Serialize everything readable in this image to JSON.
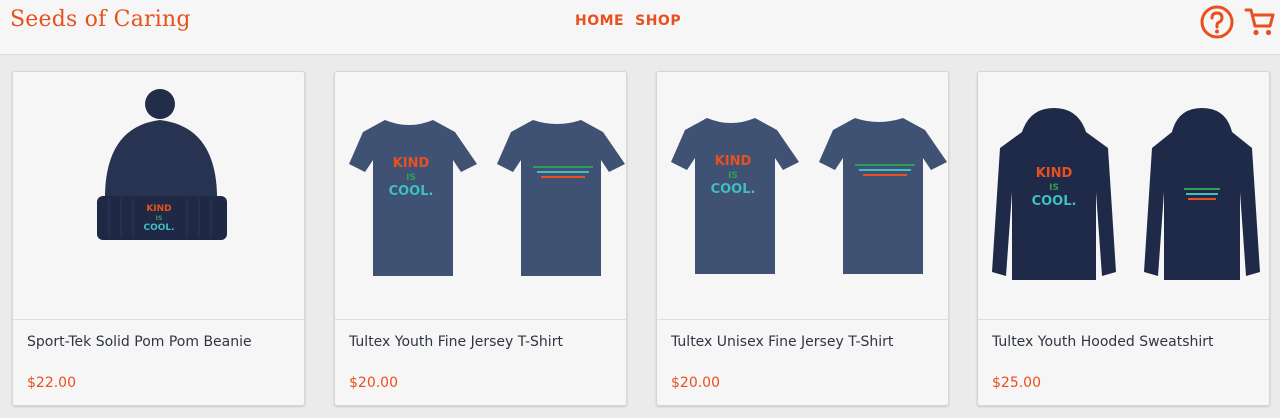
{
  "header": {
    "brand": "Seeds of Caring",
    "nav": [
      {
        "label": "HOME"
      },
      {
        "label": "SHOP"
      }
    ],
    "icons": {
      "help": "help-circle-icon",
      "cart": "shopping-cart-icon"
    }
  },
  "colors": {
    "accent": "#e8501f",
    "navy": "#1e2a48",
    "heather": "#3f5273",
    "kind_orange": "#e8501f",
    "is_green": "#2f9e57",
    "cool_teal": "#3fbfc0"
  },
  "products": [
    {
      "name": "Sport-Tek Solid Pom Pom Beanie",
      "price": "$22.00",
      "image": "beanie"
    },
    {
      "name": "Tultex Youth Fine Jersey T-Shirt",
      "price": "$20.00",
      "image": "tshirt"
    },
    {
      "name": "Tultex Unisex Fine Jersey T-Shirt",
      "price": "$20.00",
      "image": "tshirt"
    },
    {
      "name": "Tultex Youth Hooded Sweatshirt",
      "price": "$25.00",
      "image": "hoodie"
    }
  ],
  "print": {
    "kind": "KIND",
    "is": "IS",
    "cool": "COOL."
  }
}
